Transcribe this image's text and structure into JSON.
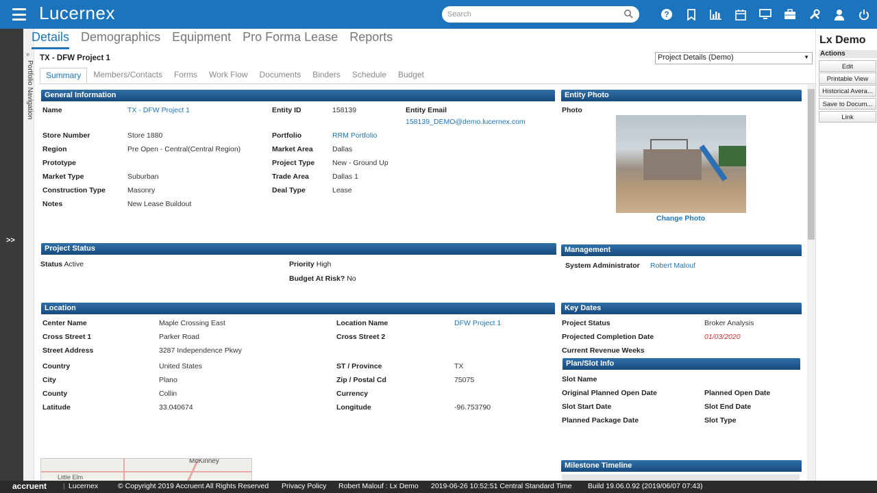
{
  "app": {
    "name": "Lucernex",
    "search_placeholder": "Search"
  },
  "top_icons": [
    "help-icon",
    "bookmark-icon",
    "bar-chart-icon",
    "calendar-icon",
    "monitor-icon",
    "briefcase-icon",
    "tools-icon",
    "user-icon",
    "power-icon"
  ],
  "left": {
    "expand": ">>",
    "portfolio_nav": "Portfolio Navigation"
  },
  "main_tabs": [
    "Details",
    "Demographics",
    "Equipment",
    "Pro Forma Lease",
    "Reports"
  ],
  "project": {
    "title": "TX - DFW Project 1",
    "selector": "Project Details (Demo)"
  },
  "sub_tabs": [
    "Summary",
    "Members/Contacts",
    "Forms",
    "Work Flow",
    "Documents",
    "Binders",
    "Schedule",
    "Budget"
  ],
  "general": {
    "header": "General Information",
    "name_label": "Name",
    "name": "TX - DFW Project 1",
    "entity_id_label": "Entity ID",
    "entity_id": "158139",
    "entity_email_label": "Entity Email",
    "entity_email": "158139_DEMO@demo.lucernex.com",
    "store_number_label": "Store Number",
    "store_number": "Store 1880",
    "portfolio_label": "Portfolio",
    "portfolio": "RRM Portfolio",
    "region_label": "Region",
    "region": "Pre Open - Central(Central Region)",
    "market_area_label": "Market Area",
    "market_area": "Dallas",
    "prototype_label": "Prototype",
    "project_type_label": "Project Type",
    "project_type": "New - Ground Up",
    "market_type_label": "Market Type",
    "market_type": "Suburban",
    "trade_area_label": "Trade Area",
    "trade_area": "Dallas 1",
    "construction_type_label": "Construction Type",
    "construction_type": "Masonry",
    "deal_type_label": "Deal Type",
    "deal_type": "Lease",
    "notes_label": "Notes",
    "notes": "New Lease Buildout"
  },
  "photo": {
    "header": "Entity Photo",
    "label": "Photo",
    "change": "Change Photo"
  },
  "status": {
    "header": "Project Status",
    "status_label": "Status",
    "status": "Active",
    "priority_label": "Priority",
    "priority": "High",
    "budget_label": "Budget At Risk?",
    "budget": "No"
  },
  "management": {
    "header": "Management",
    "role": "System Administrator",
    "person": "Robert Malouf"
  },
  "location": {
    "header": "Location",
    "center_name_label": "Center Name",
    "center_name": "Maple Crossing East",
    "location_name_label": "Location Name",
    "location_name": "DFW Project 1",
    "cross1_label": "Cross Street 1",
    "cross1": "Parker Road",
    "cross2_label": "Cross Street 2",
    "street_label": "Street Address",
    "street": "3287 Independence Pkwy",
    "country_label": "Country",
    "country": "United States",
    "st_label": "ST / Province",
    "st": "TX",
    "city_label": "City",
    "city": "Plano",
    "zip_label": "Zip / Postal Cd",
    "zip": "75075",
    "county_label": "County",
    "county": "Collin",
    "currency_label": "Currency",
    "lat_label": "Latitude",
    "lat": "33.040674",
    "lon_label": "Longitude",
    "lon": "-96.753790"
  },
  "key_dates": {
    "header": "Key Dates",
    "project_status_label": "Project Status",
    "project_status": "Broker Analysis",
    "projected_completion_label": "Projected Completion Date",
    "projected_completion": "01/03/2020",
    "revenue_weeks_label": "Current Revenue Weeks"
  },
  "plan_slot": {
    "header": "Plan/Slot Info",
    "slot_name": "Slot Name",
    "orig_open": "Original Planned Open Date",
    "planned_open": "Planned Open Date",
    "slot_start": "Slot Start Date",
    "slot_end": "Slot End Date",
    "pkg_date": "Planned Package Date",
    "slot_type": "Slot Type"
  },
  "milestone": {
    "header": "Milestone Timeline"
  },
  "map": {
    "label1": "McKinney",
    "label2": "Little Elm"
  },
  "right": {
    "title": "Lx Demo",
    "actions": "Actions",
    "buttons": [
      "Edit",
      "Printable View",
      "Historical Avera...",
      "Save to Docum...",
      "Link"
    ]
  },
  "footer": {
    "brand": "accruent",
    "product": "Lucernex",
    "copyright": "© Copyright 2019 Accruent All Rights Reserved",
    "privacy": "Privacy Policy",
    "user": "Robert Malouf : Lx Demo",
    "time": "2019-06-26 10:52:51 Central Standard Time",
    "build": "Build 19.06.0.92 (2019/06/07 07:43)"
  }
}
